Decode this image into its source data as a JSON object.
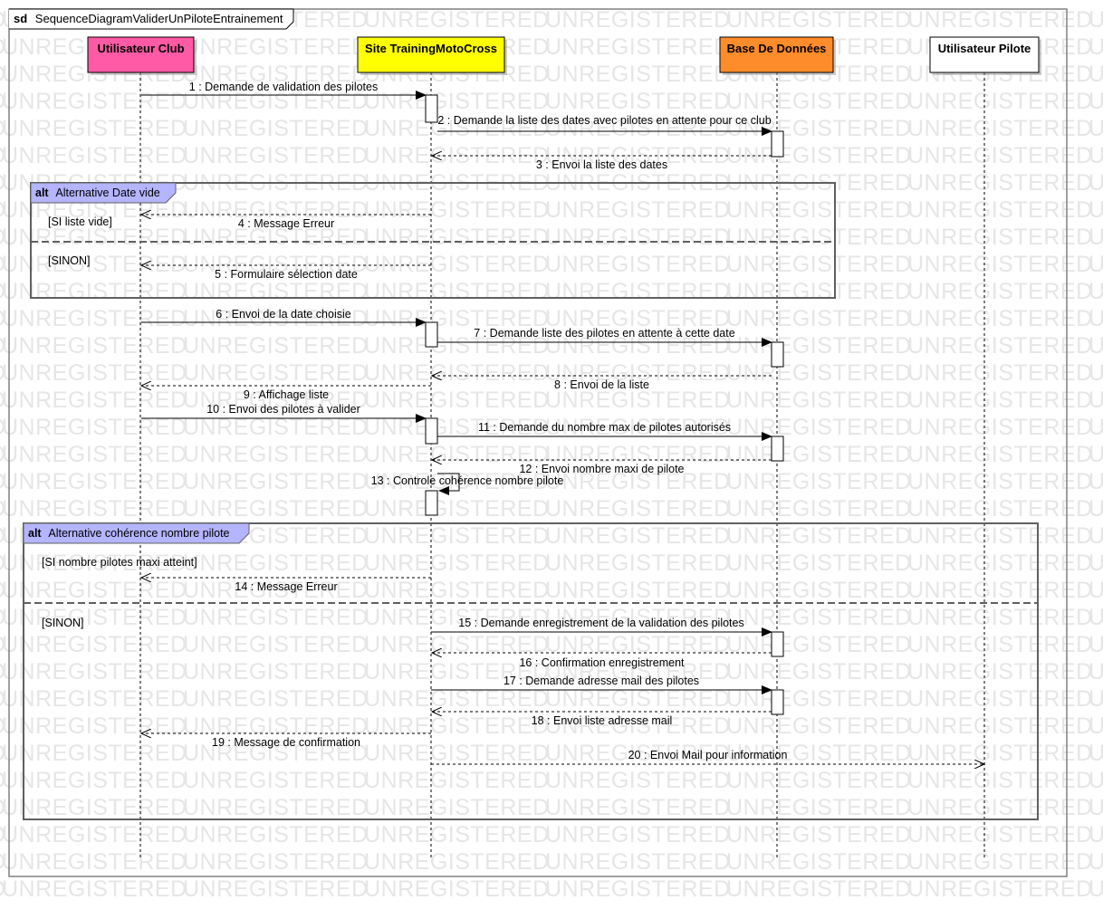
{
  "watermark": "UNREGISTERED",
  "frame": {
    "keyword": "sd",
    "title": "SequenceDiagramValiderUnPiloteEntrainement"
  },
  "colors": {
    "club": "#ff5aa5",
    "site": "#ffff00",
    "db": "#ff8c2a",
    "pilot": "#ffffff",
    "fragment_tab": "#b4b4ff"
  },
  "lifelines": [
    {
      "id": "club",
      "name": "Utilisateur Club",
      "bold": true
    },
    {
      "id": "site",
      "name": "Site TrainingMotoCross",
      "bold": true
    },
    {
      "id": "db",
      "name": "Base De Données",
      "bold": true
    },
    {
      "id": "pilot",
      "name": "Utilisateur Pilote",
      "bold": true
    }
  ],
  "fragments": [
    {
      "keyword": "alt",
      "title": "Alternative Date vide",
      "guards": [
        "[SI liste vide]",
        "[SINON]"
      ]
    },
    {
      "keyword": "alt",
      "title": "Alternative cohérence nombre pilote",
      "guards": [
        "[SI nombre pilotes maxi atteint]",
        "[SINON]"
      ]
    }
  ],
  "messages": [
    {
      "n": 1,
      "text": "1 : Demande de validation des pilotes",
      "from": "club",
      "to": "site",
      "kind": "sync"
    },
    {
      "n": 2,
      "text": "2 : Demande la liste des dates avec pilotes en attente pour ce club",
      "from": "site",
      "to": "db",
      "kind": "sync"
    },
    {
      "n": 3,
      "text": "3 : Envoi la liste des dates",
      "from": "db",
      "to": "site",
      "kind": "reply"
    },
    {
      "n": 4,
      "text": "4 : Message Erreur",
      "from": "site",
      "to": "club",
      "kind": "reply"
    },
    {
      "n": 5,
      "text": "5 : Formulaire sélection date",
      "from": "site",
      "to": "club",
      "kind": "reply"
    },
    {
      "n": 6,
      "text": "6 : Envoi de la date choisie",
      "from": "club",
      "to": "site",
      "kind": "sync"
    },
    {
      "n": 7,
      "text": "7 : Demande liste des pilotes en attente à cette date",
      "from": "site",
      "to": "db",
      "kind": "sync"
    },
    {
      "n": 8,
      "text": "8 : Envoi de la liste",
      "from": "db",
      "to": "site",
      "kind": "reply"
    },
    {
      "n": 9,
      "text": "9 : Affichage liste",
      "from": "site",
      "to": "club",
      "kind": "reply"
    },
    {
      "n": 10,
      "text": "10 : Envoi des pilotes à valider",
      "from": "club",
      "to": "site",
      "kind": "sync"
    },
    {
      "n": 11,
      "text": "11 : Demande du nombre max de pilotes autorisés",
      "from": "site",
      "to": "db",
      "kind": "sync"
    },
    {
      "n": 12,
      "text": "12 : Envoi nombre maxi de pilote",
      "from": "db",
      "to": "site",
      "kind": "reply"
    },
    {
      "n": 13,
      "text": "13 : Controle cohérence nombre pilote",
      "from": "site",
      "to": "site",
      "kind": "self"
    },
    {
      "n": 14,
      "text": "14 : Message Erreur",
      "from": "site",
      "to": "club",
      "kind": "reply"
    },
    {
      "n": 15,
      "text": "15 : Demande enregistrement de la validation des pilotes",
      "from": "site",
      "to": "db",
      "kind": "sync"
    },
    {
      "n": 16,
      "text": "16 : Confirmation enregistrement",
      "from": "db",
      "to": "site",
      "kind": "reply"
    },
    {
      "n": 17,
      "text": "17 : Demande adresse mail des pilotes",
      "from": "site",
      "to": "db",
      "kind": "sync"
    },
    {
      "n": 18,
      "text": "18 : Envoi liste adresse mail",
      "from": "db",
      "to": "site",
      "kind": "reply"
    },
    {
      "n": 19,
      "text": "19 : Message de confirmation",
      "from": "site",
      "to": "club",
      "kind": "reply"
    },
    {
      "n": 20,
      "text": "20 : Envoi Mail pour information",
      "from": "site",
      "to": "pilot",
      "kind": "async"
    }
  ]
}
